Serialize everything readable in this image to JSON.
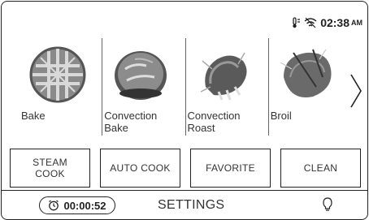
{
  "status": {
    "time": "02:38",
    "ampm": "AM",
    "icons": [
      "probe-icon",
      "wifi-icon"
    ]
  },
  "modes": [
    {
      "label": "Bake"
    },
    {
      "label": "Convection\nBake"
    },
    {
      "label": "Convection\nRoast"
    },
    {
      "label": "Broil"
    }
  ],
  "actions": {
    "steam_cook": "STEAM\nCOOK",
    "auto_cook": "AUTO COOK",
    "favorite": "FAVORITE",
    "clean": "CLEAN"
  },
  "bottom": {
    "timer": "00:00:52",
    "settings": "SETTINGS"
  }
}
